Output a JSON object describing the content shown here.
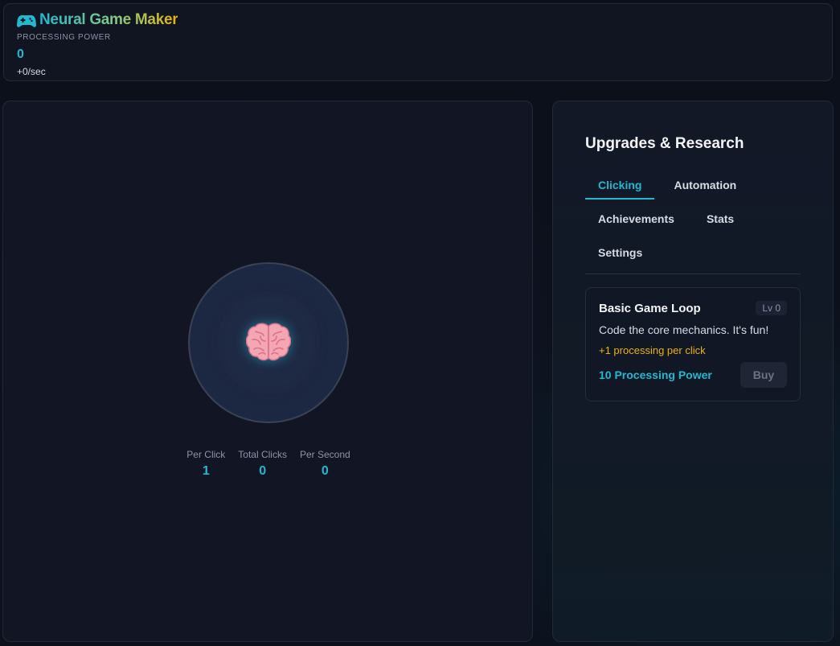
{
  "header": {
    "icon": "gamepad-icon",
    "title": "Neural Game Maker",
    "power_label": "PROCESSING POWER",
    "power_value": "0",
    "rate": "+0/sec"
  },
  "clicker": {
    "icon": "brain-icon",
    "stats": [
      {
        "label": "Per Click",
        "value": "1"
      },
      {
        "label": "Total Clicks",
        "value": "0"
      },
      {
        "label": "Per Second",
        "value": "0"
      }
    ]
  },
  "upgrades": {
    "title": "Upgrades & Research",
    "tabs": [
      {
        "label": "Clicking",
        "active": true
      },
      {
        "label": "Automation",
        "active": false
      },
      {
        "label": "Achievements",
        "active": false
      },
      {
        "label": "Stats",
        "active": false
      },
      {
        "label": "Settings",
        "active": false
      }
    ],
    "items": [
      {
        "name": "Basic Game Loop",
        "level": "Lv 0",
        "description": "Code the core mechanics. It's fun!",
        "effect": "+1 processing per click",
        "cost": "10 Processing Power",
        "buy_label": "Buy"
      }
    ]
  },
  "colors": {
    "accent": "#22b8cf",
    "effect": "#eab308",
    "background": "#0c101b"
  }
}
